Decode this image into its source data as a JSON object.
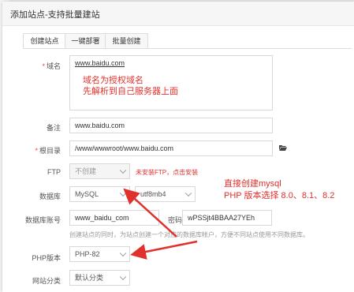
{
  "dialog": {
    "title": "添加站点-支持批量建站"
  },
  "tabs": [
    {
      "label": "创建站点"
    },
    {
      "label": "一键部署"
    },
    {
      "label": "批量创建"
    }
  ],
  "form": {
    "domain": {
      "label": "域名",
      "value": "www.baidu.com"
    },
    "remark": {
      "label": "备注",
      "value": "www.baidu.com"
    },
    "root": {
      "label": "根目录",
      "value": "/www/wwwroot/www.baidu.com"
    },
    "ftp": {
      "label": "FTP",
      "value": "不创建",
      "warning": "未安装FTP，点击安装"
    },
    "database": {
      "label": "数据库",
      "value": "MySQL",
      "charset": "utf8mb4"
    },
    "db_account": {
      "label": "数据库账号",
      "value": "www_baidu_com",
      "pwd_label": "密码",
      "pwd_value": "wPSSjt4BBAA27YEh",
      "hint": "创建站点的同时，为站点创建一个对应的数据库帐户，方便不同站点使用不同数据库。"
    },
    "php": {
      "label": "PHP版本",
      "value": "PHP-82"
    },
    "category": {
      "label": "网站分类",
      "value": "默认分类"
    }
  },
  "annotations": {
    "domain_note_1": "域名为授权域名",
    "domain_note_2": "先解析到自己服务器上面",
    "db_note_1": "直接创建mysql",
    "db_note_2": "PHP 版本选择 8.0、8.1、8.2"
  },
  "colors": {
    "annotation": "#e0312c",
    "required": "#e44"
  }
}
